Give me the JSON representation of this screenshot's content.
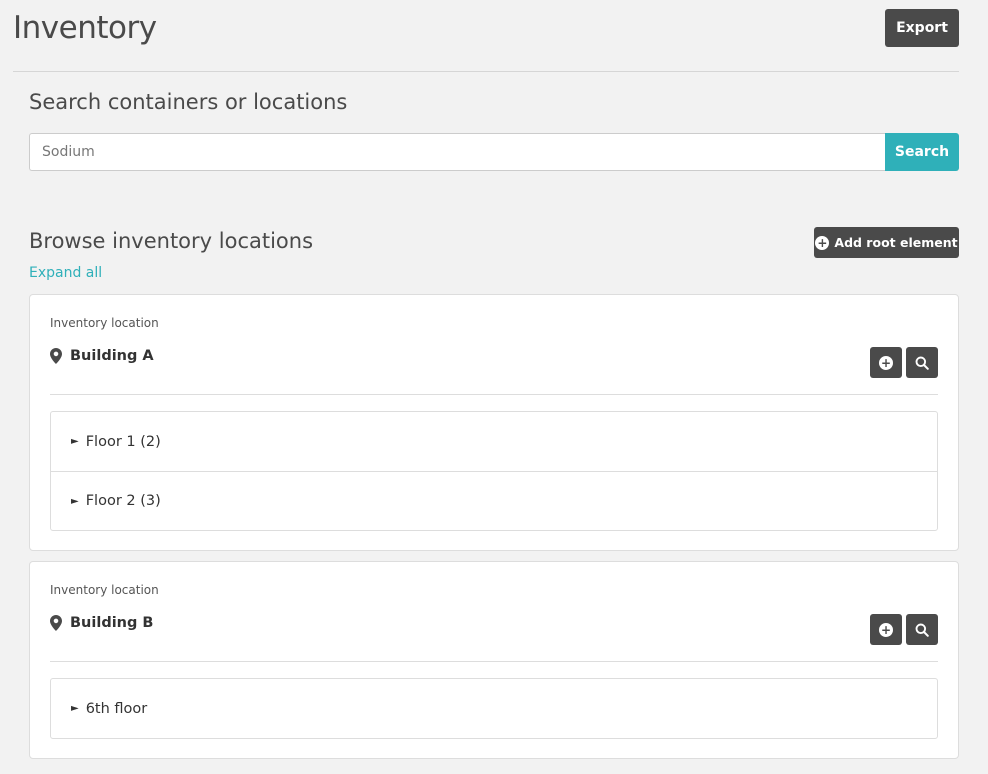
{
  "header": {
    "title": "Inventory",
    "export_label": "Export"
  },
  "search": {
    "title": "Search containers or locations",
    "placeholder": "Sodium",
    "button_label": "Search"
  },
  "browse": {
    "title": "Browse inventory locations",
    "add_root_label": "Add root element",
    "expand_all_label": "Expand all"
  },
  "locations": [
    {
      "type_label": "Inventory location",
      "name": "Building A",
      "children": [
        {
          "label": "Floor 1 (2)"
        },
        {
          "label": "Floor 2 (3)"
        }
      ]
    },
    {
      "type_label": "Inventory location",
      "name": "Building B",
      "children": [
        {
          "label": "6th floor"
        }
      ]
    }
  ],
  "icons": {
    "location": "map-pin-icon",
    "add": "plus-circle-icon",
    "search": "magnifier-icon",
    "expand": "caret-right-icon"
  },
  "colors": {
    "accent": "#2fb0b9",
    "dark_button": "#4a4a4a",
    "background": "#f2f2f2"
  }
}
